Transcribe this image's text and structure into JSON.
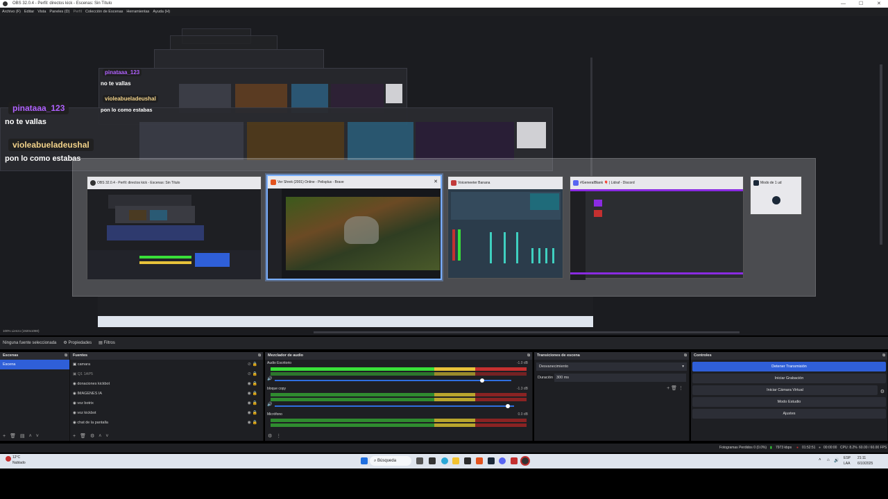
{
  "window": {
    "title": "OBS 32.0.4 - Perfil: directos kick - Escenas: Sin Título"
  },
  "menu": [
    "Archivo (F)",
    "Editar",
    "Vista",
    "Paneles (D)",
    "Perfil",
    "Colección de Escenas",
    "Herramientas",
    "Ayuda (H)"
  ],
  "chat": {
    "user1": "pinataaa_123",
    "msg1": "no te vallas",
    "user2": "violeabueladeushal",
    "msg2": "pon lo como estabas"
  },
  "switcher": {
    "windows": [
      {
        "title": "OBS 32.0.4 - Perfil: directos kick - Escenas: Sin Título"
      },
      {
        "title": "Ver Shrek (2001) Online - Pelisplus - Brave"
      },
      {
        "title": "Voicemeeter Banana"
      },
      {
        "title": "#GeneralBlank 🎈 | Lidraf - Discord"
      },
      {
        "title": "Modo de 1 ud"
      }
    ]
  },
  "canvas_status": "100%   Lienzo (1920x1080)",
  "source_toolbar": {
    "no_source": "Ninguna fuente seleccionada",
    "properties": "Propiedades",
    "filters": "Filtros"
  },
  "scenes": {
    "title": "Escenas",
    "items": [
      "Escena"
    ]
  },
  "sources": {
    "title": "Fuentes",
    "items": [
      "camara",
      "Q1 1AP5",
      "donaciones kickbot",
      "IMAGENES IA",
      "voz botrix",
      "voz kickbot",
      "chat de la pantalla"
    ]
  },
  "mixer": {
    "title": "Mezclador de audio",
    "channels": [
      {
        "name": "Audio Escritorio",
        "db": "-1.0 dB"
      },
      {
        "name": "bloque copy",
        "db": "-1.3 dB"
      },
      {
        "name": "Micrófono",
        "db": "0.0 dB"
      }
    ]
  },
  "transitions": {
    "title": "Transiciones de escena",
    "type": "Desvanecimiento",
    "duration_label": "Duración",
    "duration_value": "300 ms"
  },
  "controls": {
    "title": "Controles",
    "buttons": [
      "Detener Transmisión",
      "Iniciar Grabación",
      "Iniciar Cámara Virtual",
      "Modo Estudio",
      "Ajustes"
    ]
  },
  "status": {
    "dropped": "Fotogramas Perdidos 0 (0.0%)",
    "bitrate": "7973 kbps",
    "live_time": "01:52:51",
    "rec_time": "00:00:00",
    "cpu": "CPU: 8.2%",
    "fps": "60.00 / 60.00 FPS"
  },
  "taskbar": {
    "weather_temp": "12°C",
    "weather_desc": "Nublado",
    "search": "Búsqueda",
    "lang": "ESP",
    "lang2": "LAA",
    "time": "21:11",
    "date": "6/10/2025"
  },
  "colors": {
    "accent": "#2f5fd8",
    "chat_purple": "#b061ff",
    "chat_yellow": "#f3d38a"
  }
}
